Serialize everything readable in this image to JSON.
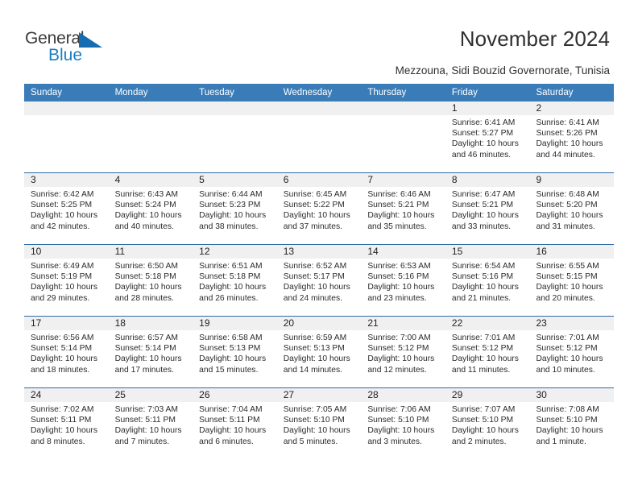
{
  "brand": {
    "name_part1": "General",
    "name_part2": "Blue",
    "logo_icon": "blue-triangle-icon",
    "color_primary": "#1b7fc4",
    "color_dark": "#3b3b3b"
  },
  "header": {
    "title": "November 2024",
    "subtitle": "Mezzouna, Sidi Bouzid Governorate, Tunisia"
  },
  "theme": {
    "header_bar_bg": "#3a7cb8",
    "header_bar_text": "#ffffff",
    "daynum_band_bg": "#f0f0f0",
    "week_divider": "#2f6ca5",
    "body_text": "#2b2b2b"
  },
  "calendar": {
    "weekdays": [
      "Sunday",
      "Monday",
      "Tuesday",
      "Wednesday",
      "Thursday",
      "Friday",
      "Saturday"
    ],
    "weeks": [
      [
        {
          "day": "",
          "lines": []
        },
        {
          "day": "",
          "lines": []
        },
        {
          "day": "",
          "lines": []
        },
        {
          "day": "",
          "lines": []
        },
        {
          "day": "",
          "lines": []
        },
        {
          "day": "1",
          "lines": [
            "Sunrise: 6:41 AM",
            "Sunset: 5:27 PM",
            "Daylight: 10 hours",
            "and 46 minutes."
          ]
        },
        {
          "day": "2",
          "lines": [
            "Sunrise: 6:41 AM",
            "Sunset: 5:26 PM",
            "Daylight: 10 hours",
            "and 44 minutes."
          ]
        }
      ],
      [
        {
          "day": "3",
          "lines": [
            "Sunrise: 6:42 AM",
            "Sunset: 5:25 PM",
            "Daylight: 10 hours",
            "and 42 minutes."
          ]
        },
        {
          "day": "4",
          "lines": [
            "Sunrise: 6:43 AM",
            "Sunset: 5:24 PM",
            "Daylight: 10 hours",
            "and 40 minutes."
          ]
        },
        {
          "day": "5",
          "lines": [
            "Sunrise: 6:44 AM",
            "Sunset: 5:23 PM",
            "Daylight: 10 hours",
            "and 38 minutes."
          ]
        },
        {
          "day": "6",
          "lines": [
            "Sunrise: 6:45 AM",
            "Sunset: 5:22 PM",
            "Daylight: 10 hours",
            "and 37 minutes."
          ]
        },
        {
          "day": "7",
          "lines": [
            "Sunrise: 6:46 AM",
            "Sunset: 5:21 PM",
            "Daylight: 10 hours",
            "and 35 minutes."
          ]
        },
        {
          "day": "8",
          "lines": [
            "Sunrise: 6:47 AM",
            "Sunset: 5:21 PM",
            "Daylight: 10 hours",
            "and 33 minutes."
          ]
        },
        {
          "day": "9",
          "lines": [
            "Sunrise: 6:48 AM",
            "Sunset: 5:20 PM",
            "Daylight: 10 hours",
            "and 31 minutes."
          ]
        }
      ],
      [
        {
          "day": "10",
          "lines": [
            "Sunrise: 6:49 AM",
            "Sunset: 5:19 PM",
            "Daylight: 10 hours",
            "and 29 minutes."
          ]
        },
        {
          "day": "11",
          "lines": [
            "Sunrise: 6:50 AM",
            "Sunset: 5:18 PM",
            "Daylight: 10 hours",
            "and 28 minutes."
          ]
        },
        {
          "day": "12",
          "lines": [
            "Sunrise: 6:51 AM",
            "Sunset: 5:18 PM",
            "Daylight: 10 hours",
            "and 26 minutes."
          ]
        },
        {
          "day": "13",
          "lines": [
            "Sunrise: 6:52 AM",
            "Sunset: 5:17 PM",
            "Daylight: 10 hours",
            "and 24 minutes."
          ]
        },
        {
          "day": "14",
          "lines": [
            "Sunrise: 6:53 AM",
            "Sunset: 5:16 PM",
            "Daylight: 10 hours",
            "and 23 minutes."
          ]
        },
        {
          "day": "15",
          "lines": [
            "Sunrise: 6:54 AM",
            "Sunset: 5:16 PM",
            "Daylight: 10 hours",
            "and 21 minutes."
          ]
        },
        {
          "day": "16",
          "lines": [
            "Sunrise: 6:55 AM",
            "Sunset: 5:15 PM",
            "Daylight: 10 hours",
            "and 20 minutes."
          ]
        }
      ],
      [
        {
          "day": "17",
          "lines": [
            "Sunrise: 6:56 AM",
            "Sunset: 5:14 PM",
            "Daylight: 10 hours",
            "and 18 minutes."
          ]
        },
        {
          "day": "18",
          "lines": [
            "Sunrise: 6:57 AM",
            "Sunset: 5:14 PM",
            "Daylight: 10 hours",
            "and 17 minutes."
          ]
        },
        {
          "day": "19",
          "lines": [
            "Sunrise: 6:58 AM",
            "Sunset: 5:13 PM",
            "Daylight: 10 hours",
            "and 15 minutes."
          ]
        },
        {
          "day": "20",
          "lines": [
            "Sunrise: 6:59 AM",
            "Sunset: 5:13 PM",
            "Daylight: 10 hours",
            "and 14 minutes."
          ]
        },
        {
          "day": "21",
          "lines": [
            "Sunrise: 7:00 AM",
            "Sunset: 5:12 PM",
            "Daylight: 10 hours",
            "and 12 minutes."
          ]
        },
        {
          "day": "22",
          "lines": [
            "Sunrise: 7:01 AM",
            "Sunset: 5:12 PM",
            "Daylight: 10 hours",
            "and 11 minutes."
          ]
        },
        {
          "day": "23",
          "lines": [
            "Sunrise: 7:01 AM",
            "Sunset: 5:12 PM",
            "Daylight: 10 hours",
            "and 10 minutes."
          ]
        }
      ],
      [
        {
          "day": "24",
          "lines": [
            "Sunrise: 7:02 AM",
            "Sunset: 5:11 PM",
            "Daylight: 10 hours",
            "and 8 minutes."
          ]
        },
        {
          "day": "25",
          "lines": [
            "Sunrise: 7:03 AM",
            "Sunset: 5:11 PM",
            "Daylight: 10 hours",
            "and 7 minutes."
          ]
        },
        {
          "day": "26",
          "lines": [
            "Sunrise: 7:04 AM",
            "Sunset: 5:11 PM",
            "Daylight: 10 hours",
            "and 6 minutes."
          ]
        },
        {
          "day": "27",
          "lines": [
            "Sunrise: 7:05 AM",
            "Sunset: 5:10 PM",
            "Daylight: 10 hours",
            "and 5 minutes."
          ]
        },
        {
          "day": "28",
          "lines": [
            "Sunrise: 7:06 AM",
            "Sunset: 5:10 PM",
            "Daylight: 10 hours",
            "and 3 minutes."
          ]
        },
        {
          "day": "29",
          "lines": [
            "Sunrise: 7:07 AM",
            "Sunset: 5:10 PM",
            "Daylight: 10 hours",
            "and 2 minutes."
          ]
        },
        {
          "day": "30",
          "lines": [
            "Sunrise: 7:08 AM",
            "Sunset: 5:10 PM",
            "Daylight: 10 hours",
            "and 1 minute."
          ]
        }
      ]
    ]
  }
}
